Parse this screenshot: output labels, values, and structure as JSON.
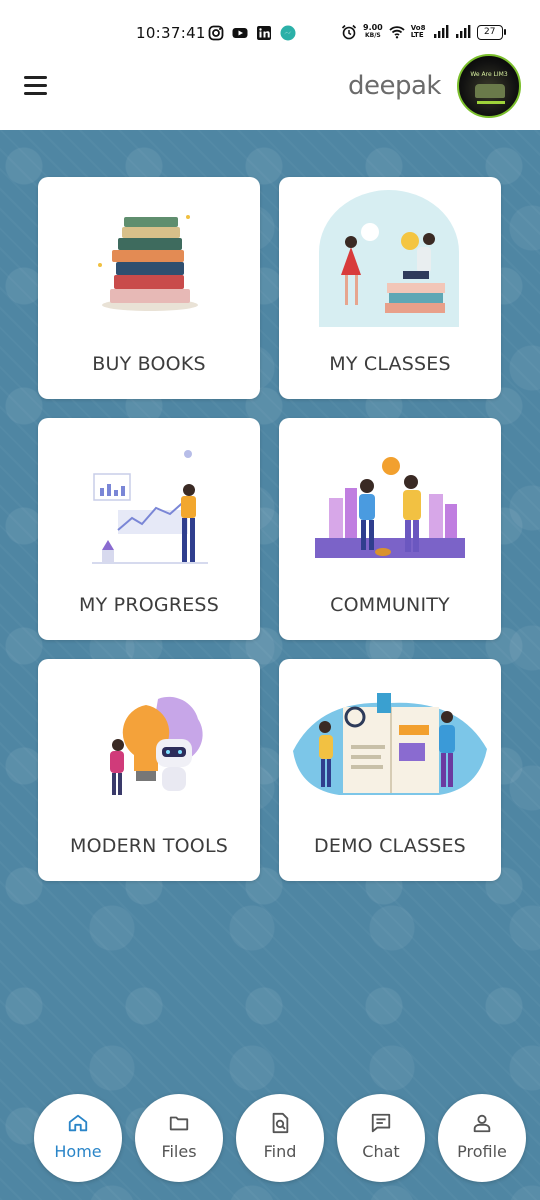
{
  "status_bar": {
    "time": "10:37:41",
    "net_speed": "9.00",
    "net_unit": "KB/S",
    "volte": "Vo8 LTE",
    "battery": "27"
  },
  "header": {
    "brand": "deepak",
    "avatar_text": "We Are LIM3"
  },
  "cards": [
    {
      "label": "BUY BOOKS",
      "icon": "books-stack-illustration"
    },
    {
      "label": "MY CLASSES",
      "icon": "classes-illustration"
    },
    {
      "label": "MY PROGRESS",
      "icon": "progress-chart-illustration"
    },
    {
      "label": "COMMUNITY",
      "icon": "community-illustration"
    },
    {
      "label": "MODERN TOOLS",
      "icon": "robot-lightbulb-illustration"
    },
    {
      "label": "DEMO CLASSES",
      "icon": "book-magnifier-illustration"
    }
  ],
  "nav": [
    {
      "label": "Home",
      "icon": "home-icon",
      "active": true
    },
    {
      "label": "Files",
      "icon": "folder-icon",
      "active": false
    },
    {
      "label": "Find",
      "icon": "search-document-icon",
      "active": false
    },
    {
      "label": "Chat",
      "icon": "chat-icon",
      "active": false
    },
    {
      "label": "Profile",
      "icon": "person-icon",
      "active": false
    }
  ],
  "colors": {
    "background": "#4f86a3",
    "active_nav": "#2a85c8",
    "card_text": "#3d3d3d"
  }
}
